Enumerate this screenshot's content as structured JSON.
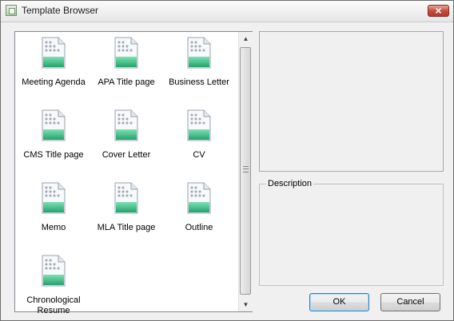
{
  "window": {
    "title": "Template Browser"
  },
  "templates": [
    {
      "label": "Meeting Agenda"
    },
    {
      "label": "APA Title page"
    },
    {
      "label": "Business Letter"
    },
    {
      "label": "CMS Title page"
    },
    {
      "label": "Cover Letter"
    },
    {
      "label": "CV"
    },
    {
      "label": "Memo"
    },
    {
      "label": "MLA Title page"
    },
    {
      "label": "Outline"
    },
    {
      "label": "Chronological Resume"
    }
  ],
  "description": {
    "label": "Description"
  },
  "buttons": {
    "ok": "OK",
    "cancel": "Cancel"
  },
  "icons": {
    "title": "app-window-icon",
    "close": "close-icon",
    "item": "document-template-icon"
  },
  "colors": {
    "close_red": "#c44a3b",
    "doc_green": "#3bbf8a",
    "ok_border": "#3c7fb1"
  }
}
